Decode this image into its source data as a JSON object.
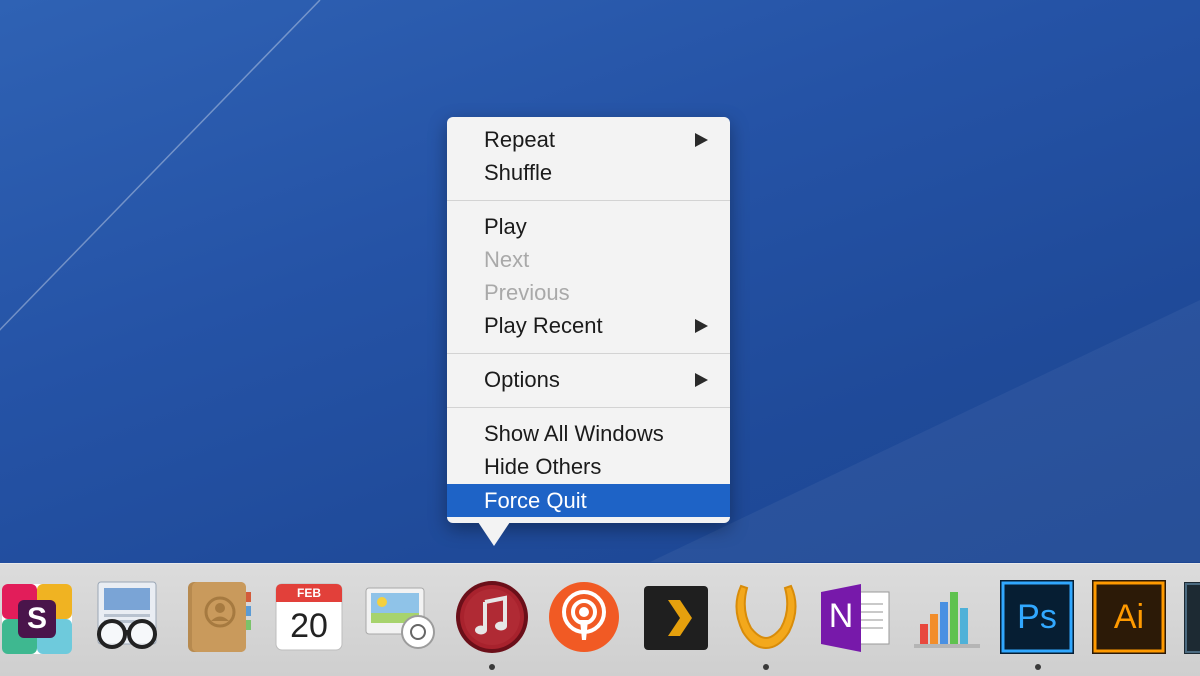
{
  "context_menu": {
    "items": [
      {
        "label": "Repeat",
        "submenu": true
      },
      {
        "label": "Shuffle"
      },
      {
        "label": "Play"
      },
      {
        "label": "Next",
        "disabled": true
      },
      {
        "label": "Previous",
        "disabled": true
      },
      {
        "label": "Play Recent",
        "submenu": true
      },
      {
        "label": "Options",
        "submenu": true
      },
      {
        "label": "Show All Windows"
      },
      {
        "label": "Hide Others"
      },
      {
        "label": "Force Quit",
        "selected": true
      }
    ]
  },
  "dock": {
    "apps": [
      {
        "name": "slack-icon",
        "letter": "S"
      },
      {
        "name": "preview-icon"
      },
      {
        "name": "contacts-icon"
      },
      {
        "name": "calendar-icon",
        "month": "FEB",
        "day": "20"
      },
      {
        "name": "image-capture-icon"
      },
      {
        "name": "itunes-icon",
        "running": true
      },
      {
        "name": "podcasts-icon"
      },
      {
        "name": "plex-icon"
      },
      {
        "name": "vox-icon",
        "running": true
      },
      {
        "name": "onenote-icon",
        "letter": "N"
      },
      {
        "name": "numbers-icon"
      },
      {
        "name": "photoshop-icon",
        "letter": "Ps",
        "running": true
      },
      {
        "name": "illustrator-icon",
        "letter": "Ai"
      }
    ]
  },
  "colors": {
    "desktop": "#2553a6",
    "menu_bg": "#f3f3f3",
    "selected": "#1e63c6",
    "disabled_text": "#a9a9a9"
  }
}
